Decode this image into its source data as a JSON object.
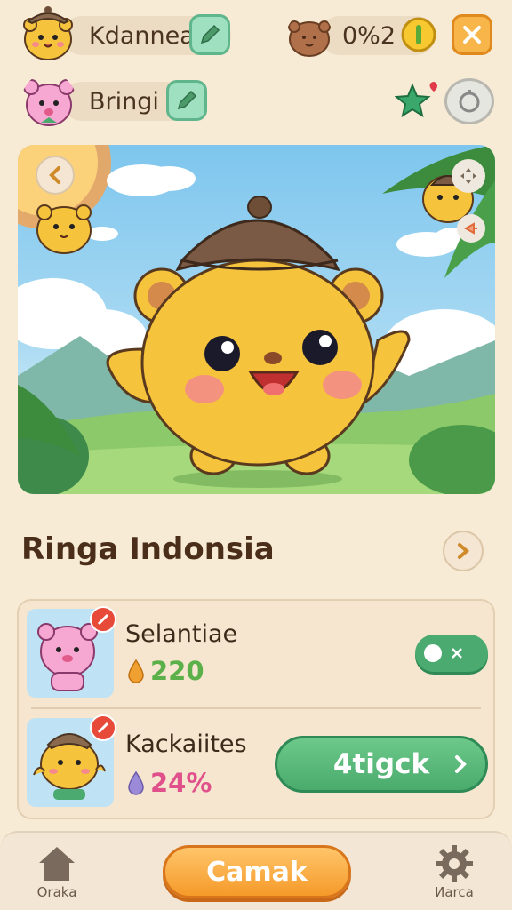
{
  "header": {
    "player1_name": "Kdannea",
    "player2_name": "Bringi",
    "progress_text": "0%2"
  },
  "section": {
    "title": "Ringa Indonsia"
  },
  "items": [
    {
      "name": "Selantiae",
      "value": "220",
      "value_color": "#5cb04a"
    },
    {
      "name": "Kackaiites",
      "value": "24%",
      "value_color": "#e0508a",
      "action_label": "4tigck"
    }
  ],
  "bottom_nav": {
    "left_label": "Oraka",
    "main_button": "Camak",
    "right_label": "Иarca"
  },
  "colors": {
    "background": "#f8ebd6",
    "accent_green": "#4aaa70",
    "accent_orange": "#f59a2a"
  }
}
